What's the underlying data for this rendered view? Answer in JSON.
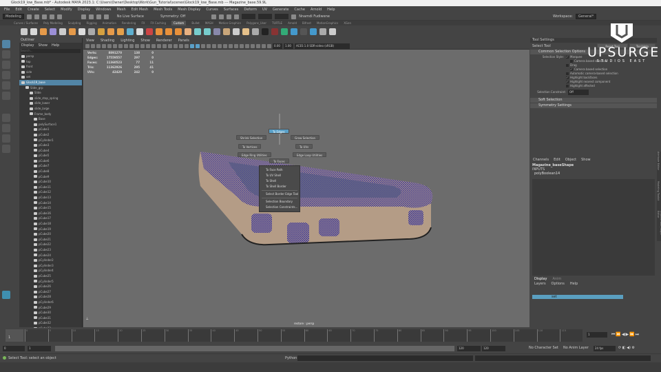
{
  "window": {
    "title": "Glock19_low_Base.mb* - Autodesk MAYA 2023.1: C:\\Users\\Owner\\Desktop\\Work\\Gun_Tutorial\\scenes\\Glock19_low_Base.mb   ---   Magazine_base.59.9L"
  },
  "menubar": [
    "File",
    "Edit",
    "Create",
    "Select",
    "Modify",
    "Display",
    "Windows",
    "Mesh",
    "Edit Mesh",
    "Mesh Tools",
    "Mesh Display",
    "Curves",
    "Surfaces",
    "Deform",
    "UV",
    "Generate",
    "Cache",
    "Arnold",
    "Help"
  ],
  "statusline": {
    "mode": "Modeling",
    "live_surface": "No Live Surface",
    "symmetry": "Symmetry: Off",
    "user": "Nnamdi Fudiwene",
    "workspace_label": "Workspace:",
    "workspace": "General*"
  },
  "shelf_tabs": [
    "Curves / Surfaces",
    "Poly Modeling",
    "Sculpting",
    "Rigging",
    "Animation",
    "Rendering",
    "FX",
    "FX Caching",
    "Custom",
    "Bullet",
    "MASH",
    "Motion Graphics",
    "Polygons_User",
    "TURTLE",
    "Arnold",
    "Bifrost",
    "MotionGraphics",
    "XGen"
  ],
  "shelf_active": "Custom",
  "outliner": {
    "title": "Outliner",
    "menu": [
      "Display",
      "Show",
      "Help"
    ],
    "search_placeholder": "Search...",
    "items": [
      {
        "label": "persp",
        "depth": 0
      },
      {
        "label": "top",
        "depth": 0
      },
      {
        "label": "front",
        "depth": 0
      },
      {
        "label": "side",
        "depth": 0
      },
      {
        "label": "set",
        "depth": 0
      },
      {
        "label": "Glock19_base",
        "depth": 0,
        "selected": true
      },
      {
        "label": "Slide_grp",
        "depth": 1
      },
      {
        "label": "Slide",
        "depth": 2
      },
      {
        "label": "slide_stop_spring",
        "depth": 2
      },
      {
        "label": "slide_lower",
        "depth": 2
      },
      {
        "label": "slide_large",
        "depth": 2
      },
      {
        "label": "Frame_body",
        "depth": 2
      },
      {
        "label": "Base",
        "depth": 3
      },
      {
        "label": "polySurface1",
        "depth": 3
      },
      {
        "label": "pCube1",
        "depth": 3
      },
      {
        "label": "pCube2",
        "depth": 3
      },
      {
        "label": "pCylinder1",
        "depth": 3
      },
      {
        "label": "pCube3",
        "depth": 3
      },
      {
        "label": "pCube4",
        "depth": 3
      },
      {
        "label": "pCube5",
        "depth": 3
      },
      {
        "label": "pCube6",
        "depth": 3
      },
      {
        "label": "pCube7",
        "depth": 3
      },
      {
        "label": "pCube8",
        "depth": 3
      },
      {
        "label": "pCube9",
        "depth": 3
      },
      {
        "label": "pCube10",
        "depth": 3
      },
      {
        "label": "pCube11",
        "depth": 3
      },
      {
        "label": "pCube12",
        "depth": 3
      },
      {
        "label": "pCube13",
        "depth": 3
      },
      {
        "label": "pCube14",
        "depth": 3
      },
      {
        "label": "pCube15",
        "depth": 3
      },
      {
        "label": "pCube16",
        "depth": 3
      },
      {
        "label": "pCube17",
        "depth": 3
      },
      {
        "label": "pCube18",
        "depth": 3
      },
      {
        "label": "pCube19",
        "depth": 3
      },
      {
        "label": "pCube20",
        "depth": 3
      },
      {
        "label": "pCube21",
        "depth": 3
      },
      {
        "label": "pCube22",
        "depth": 3
      },
      {
        "label": "pCube23",
        "depth": 3
      },
      {
        "label": "pCube24",
        "depth": 3
      },
      {
        "label": "pCylinder2",
        "depth": 3
      },
      {
        "label": "pCylinder3",
        "depth": 3
      },
      {
        "label": "pCylinder4",
        "depth": 3
      },
      {
        "label": "pCube25",
        "depth": 3
      },
      {
        "label": "pCylinder5",
        "depth": 3
      },
      {
        "label": "pCube26",
        "depth": 3
      },
      {
        "label": "pCube27",
        "depth": 3
      },
      {
        "label": "pCube28",
        "depth": 3
      },
      {
        "label": "pCylinder6",
        "depth": 3
      },
      {
        "label": "pCube29",
        "depth": 3
      },
      {
        "label": "pCube30",
        "depth": 3
      },
      {
        "label": "pCube31",
        "depth": 3
      },
      {
        "label": "pCube32",
        "depth": 3
      },
      {
        "label": "pCube33",
        "depth": 3
      },
      {
        "label": "pCube34",
        "depth": 3
      }
    ]
  },
  "viewport": {
    "menu": [
      "View",
      "Shading",
      "Lighting",
      "Show",
      "Renderer",
      "Panels"
    ],
    "exposure": "0.00",
    "gamma": "1.00",
    "color_space": "ACES 1.0 SDR-video (sRGB)",
    "camera": "restore : persp",
    "hud": [
      [
        "Verts:",
        "8891270",
        "138",
        "0"
      ],
      [
        "Edges:",
        "17559557",
        "297",
        "0"
      ],
      [
        "Faces:",
        "11360523",
        "77",
        "11"
      ],
      [
        "Tris:",
        "11362926",
        "295",
        "41"
      ],
      [
        "UVs:",
        "42420",
        "242",
        "0"
      ]
    ]
  },
  "marking_menu": {
    "north": "To Edges",
    "west": "Shrink Selection",
    "east": "Grow Selection",
    "w2": "To Vertices",
    "e2": "To UVs",
    "sw": "Edge Ring Utilities",
    "se": "Edge Loop Utilities",
    "south": "To Faces",
    "submenu": [
      "To Face Path",
      "To UV Shell",
      "To Shell",
      "To Shell Border",
      "Select Border Edge Tool",
      "Selection Boundary",
      "Selection Constraints..."
    ]
  },
  "tool_settings": {
    "title": "Tool Settings",
    "tool": "Select Tool",
    "reset": "Reset Tool",
    "help": "Tool Help",
    "section": "Common Selection Options",
    "style_label": "Selection Style:",
    "options": [
      {
        "label": "Marquee",
        "checked": true
      },
      {
        "label": "Camera based selection",
        "checked": false
      },
      {
        "label": "Drag",
        "checked": false
      },
      {
        "label": "Camera based selection",
        "checked": true
      },
      {
        "label": "Automatic camera-based selection",
        "checked": false
      },
      {
        "label": "Highlight backfaces",
        "checked": true
      },
      {
        "label": "Highlight nearest component",
        "checked": true
      },
      {
        "label": "Highlight affected",
        "checked": false
      }
    ],
    "constraint_label": "Selection Constraint:",
    "constraint": "Off",
    "sections": [
      "Soft Selection",
      "Symmetry Settings"
    ]
  },
  "channel_box": {
    "menu": [
      "Channels",
      "Edit",
      "Object",
      "Show"
    ],
    "object": "Magazine_baseShape",
    "inputs": "INPUTS",
    "input_node": "polyBoolean14",
    "side_tabs": [
      "Attribute Editor",
      "Modeling Toolkit",
      "Channel Box / Layer Editor"
    ]
  },
  "layer_editor": {
    "tabs": [
      "Display",
      "Anim"
    ],
    "menu": [
      "Layers",
      "Options",
      "Help"
    ],
    "layer": "set"
  },
  "logo": {
    "name": "UPSURGE",
    "sub": "STUDIOS EAST"
  },
  "time": {
    "current": "1",
    "range_start": "0",
    "range_start2": "1",
    "range_end": "120",
    "range_end2": "120",
    "anim_end": "200",
    "character": "No Character Set",
    "anim_layer": "No Anim Layer",
    "fps": "24 fps",
    "ticks": [
      "0",
      "5",
      "10",
      "15",
      "20",
      "25",
      "30",
      "35",
      "40",
      "45",
      "50",
      "55",
      "60",
      "65",
      "70",
      "75",
      "80",
      "85",
      "90",
      "95",
      "100",
      "105",
      "110",
      "115"
    ]
  },
  "help_line": "Select Tool: select an object",
  "command": {
    "lang": "Python"
  },
  "colors": {
    "selection": "#5285a6",
    "wire": "#1e1ea0",
    "mesh": "#b49c86",
    "viewport": "#6c6c6c"
  }
}
